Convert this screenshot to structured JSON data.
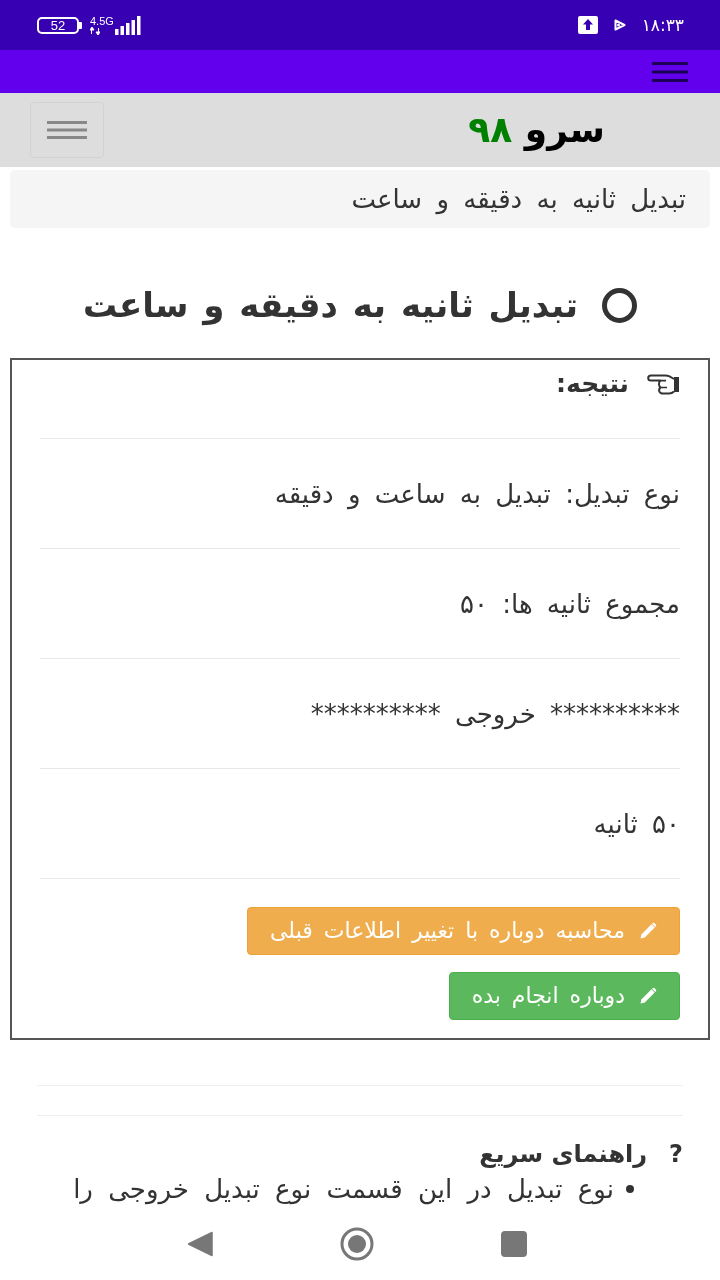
{
  "status_bar": {
    "battery": "52",
    "network": "4.5G",
    "time": "۱۸:۳۳"
  },
  "site_header": {
    "logo_name": "سرو",
    "logo_number": "۹۸"
  },
  "breadcrumb": "تبدیل ثانیه به دقیقه و ساعت",
  "page_title": "تبدیل ثانیه به دقیقه و ساعت",
  "result": {
    "heading": "نتیجه:",
    "rows": [
      "نوع تبدیل: تبدیل به ساعت و دقیقه",
      "مجموع ثانیه ها: ۵۰",
      "********** خروجی **********",
      "۵۰ ثانیه"
    ],
    "buttons": [
      {
        "label": "محاسبه دوباره با تغییر اطلاعات قبلی",
        "kind": "warning"
      },
      {
        "label": "دوباره انجام بده",
        "kind": "success"
      }
    ]
  },
  "quick_help": {
    "icon": "?",
    "heading": "راهنمای سریع",
    "items": [
      "نوع تبدیل در این قسمت نوع تبدیل خروجی را"
    ]
  }
}
